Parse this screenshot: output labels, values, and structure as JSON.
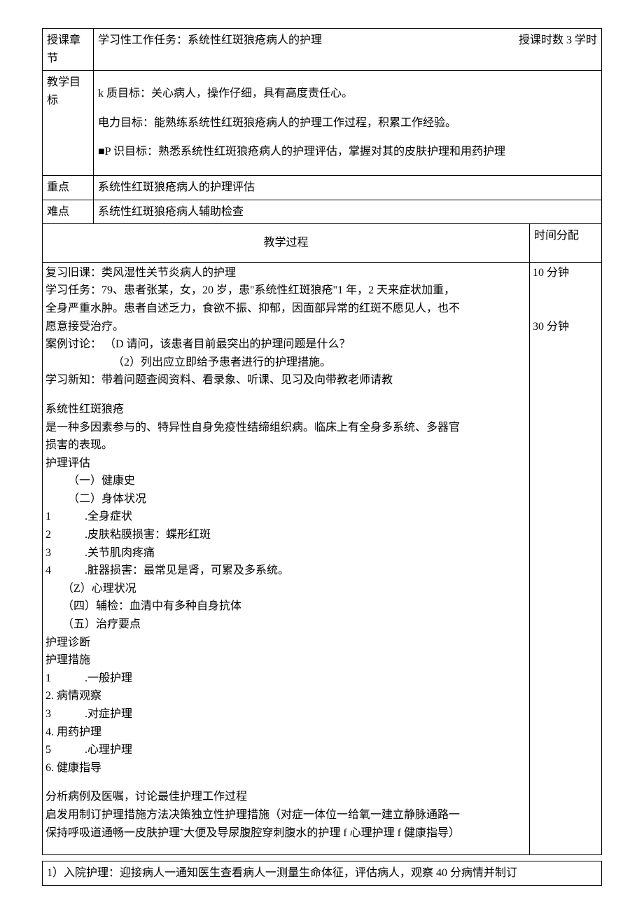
{
  "header": {
    "chapter_label": "授课章节",
    "task_text": "学习性工作任务：系统性红斑狼疮病人的护理",
    "hours_label": "授课时数",
    "hours_value": "3 学时"
  },
  "objectives": {
    "row_label": "教学目标",
    "line1": "k 质目标：关心病人，操作仔细，具有高度责任心。",
    "line2": "电力目标：能熟练系统性红斑狼疮病人的护理工作过程，积累工作经验。",
    "line3": "■P 识目标：熟悉系统性红斑狼疮病人的护理评估，掌握对其的皮肤护理和用药护理"
  },
  "keypoint": {
    "label": "重点",
    "text": "系统性红斑狼疮病人的护理评估"
  },
  "difficulty": {
    "label": "难点",
    "text": "系统性红斑狼疮病人辅助检查"
  },
  "process": {
    "header_col1": "教学过程",
    "header_col2": "时间分配",
    "time1": "10 分钟",
    "time2": "30 分钟",
    "review_line": "复习旧课：类风湿性关节炎病人的护理",
    "task_line1": "学习任务：79、患者张某，女，20 岁，患\"系统性红斑狼疮\"1 年，2 天来症状加重，",
    "task_line2": "全身严重水肿。患者自述乏力，食欲不振、抑郁，因面部异常的红斑不愿见人，也不",
    "task_line3": "愿意接受治疗。",
    "case_line1": "案例讨论： （D 请问，该患者目前最突出的护理问题是什么？",
    "case_line2": "（2）列出应立即给予患者进行的护理措施。",
    "newlearn_line": "学习新知：带着问题查阅资料、看录象、听课、见习及向带教老师请教",
    "disease_title": "系统性红斑狼疮",
    "disease_desc1": "是一种多因素参与的、特异性自身免疫性结缔组织病。临床上有全身多系统、多器官",
    "disease_desc2": "损害的表现。",
    "assess_title": "护理评估",
    "assess_1": "（一）健康史",
    "assess_2": "（二）身体状况",
    "body_items": [
      ".全身症状",
      ".皮肤粘膜损害：蝶形红斑",
      ".关节肌肉疼痛",
      ".脏器损害：最常见是肾，可累及多系统。"
    ],
    "assess_z": "（Z）心理状况",
    "assess_4": "（四）辅检：血清中有多种自身抗体",
    "assess_5": "（五）治疗要点",
    "dx_title": "护理诊断",
    "measure_title": "护理措施",
    "m1_num": "1",
    "m1_text": ".一般护理",
    "m2": "2. 病情观察",
    "m3_num": "3",
    "m3_text": ".对症护理",
    "m4": "4. 用药护理",
    "m5_num": "5",
    "m5_text": ".心理护理",
    "m6": "6. 健康指导",
    "analysis_line": "分析病例及医嘱，讨论最佳护理工作过程",
    "inspire_line1": "启发用制订护理措施方法决策独立性护理措施（对症一体位一给氧一建立静脉通路一",
    "inspire_line2": "保持呼吸道通畅一皮肤护理˜大便及导尿腹腔穿刺腹水的护理 f 心理护理 f 健康指导）"
  },
  "appendix": {
    "line": "1）入院护理：迎接病人一通知医生查看病人一测量生命体征，评估病人，观察 40 分病情并制订"
  }
}
